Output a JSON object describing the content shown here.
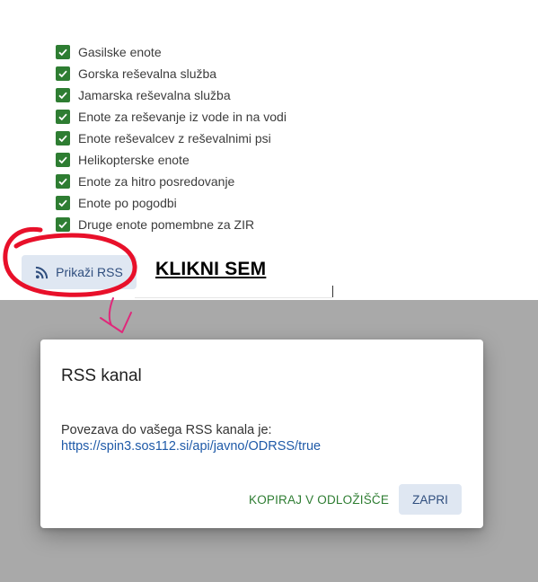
{
  "checklist": {
    "items": [
      {
        "label": "Gasilske enote",
        "checked": true
      },
      {
        "label": "Gorska reševalna služba",
        "checked": true
      },
      {
        "label": "Jamarska reševalna služba",
        "checked": true
      },
      {
        "label": "Enote za reševanje iz vode in na vodi",
        "checked": true
      },
      {
        "label": "Enote reševalcev z reševalnimi psi",
        "checked": true
      },
      {
        "label": "Helikopterske enote",
        "checked": true
      },
      {
        "label": "Enote za hitro posredovanje",
        "checked": true
      },
      {
        "label": "Enote po pogodbi",
        "checked": true
      },
      {
        "label": "Druge enote pomembne za ZIR",
        "checked": true
      }
    ]
  },
  "rss_button": {
    "label": "Prikaži RSS",
    "icon": "rss-icon"
  },
  "annotation": {
    "text": "KLIKNI SEM"
  },
  "dialog": {
    "title": "RSS kanal",
    "text": "Povezava do vašega RSS kanala je:",
    "link": "https://spin3.sos112.si/api/javno/ODRSS/true",
    "copy_label": "KOPIRAJ V ODLOŽIŠČE",
    "close_label": "ZAPRI"
  },
  "colors": {
    "checkbox": "#2e7d32",
    "button_bg": "#dfe7f2",
    "button_text": "#2f4e7e",
    "link": "#1f5aa8",
    "annotation_marker": "#e8102a"
  }
}
